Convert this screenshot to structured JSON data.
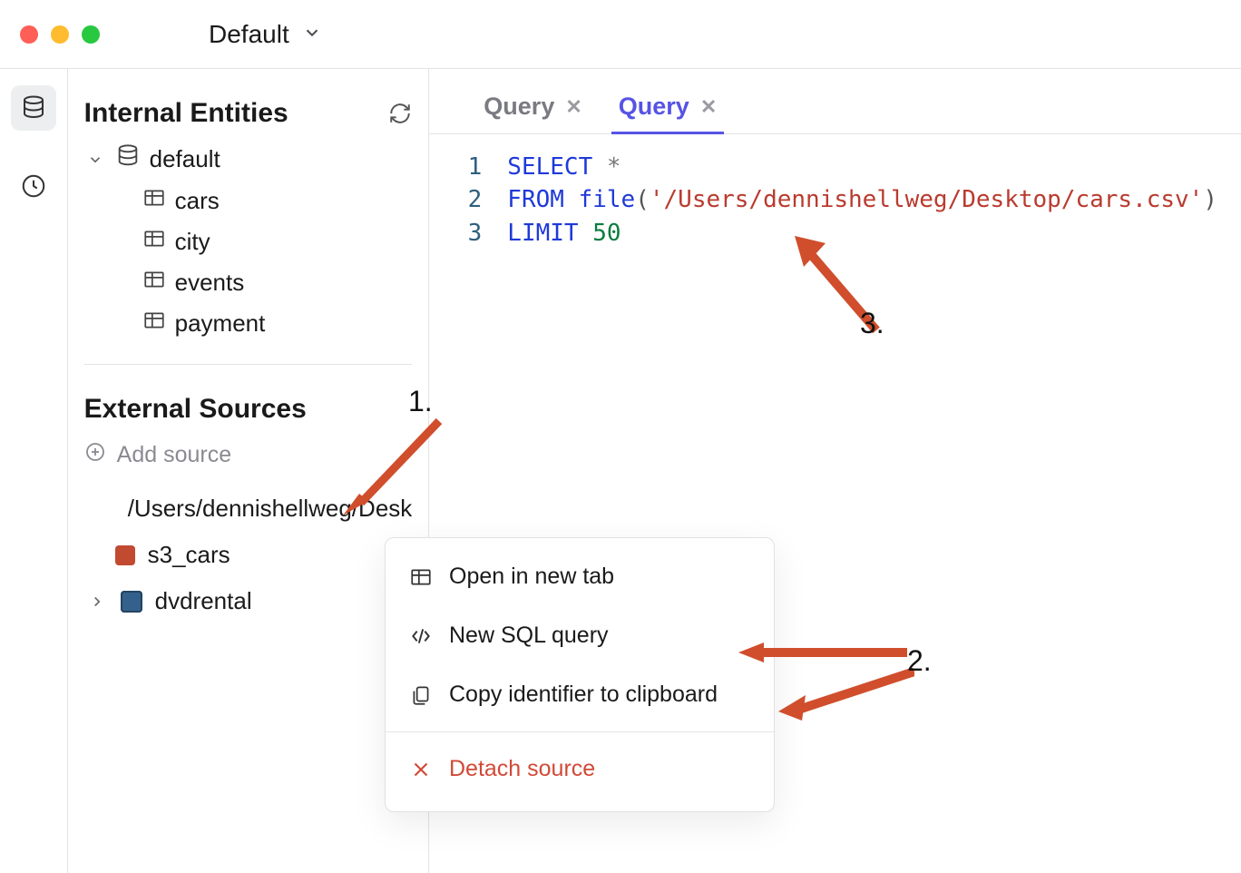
{
  "titlebar": {
    "project_name": "Default"
  },
  "sidebar": {
    "internal": {
      "title": "Internal Entities",
      "db_name": "default",
      "tables": [
        "cars",
        "city",
        "events",
        "payment"
      ]
    },
    "external": {
      "title": "External Sources",
      "add_label": "Add source",
      "file_source": "/Users/dennishellweg/Desk",
      "s3_source": "s3_cars",
      "pg_source": "dvdrental"
    }
  },
  "tabs": [
    {
      "label": "Query",
      "active": false
    },
    {
      "label": "Query",
      "active": true
    }
  ],
  "code": {
    "line_numbers": [
      "1",
      "2",
      "3"
    ],
    "kw_select": "SELECT",
    "star": " *",
    "kw_from": "FROM",
    "fn_file": " file",
    "open_paren": "(",
    "str_path": "'/Users/dennishellweg/Desktop/cars.csv'",
    "close_paren": ")",
    "kw_limit": "LIMIT ",
    "num_limit": "50"
  },
  "context_menu": {
    "open_tab": "Open in new tab",
    "new_sql": "New SQL query",
    "copy_id": "Copy identifier to clipboard",
    "detach": "Detach source"
  },
  "annotations": {
    "one": "1.",
    "two": "2.",
    "three": "3."
  }
}
